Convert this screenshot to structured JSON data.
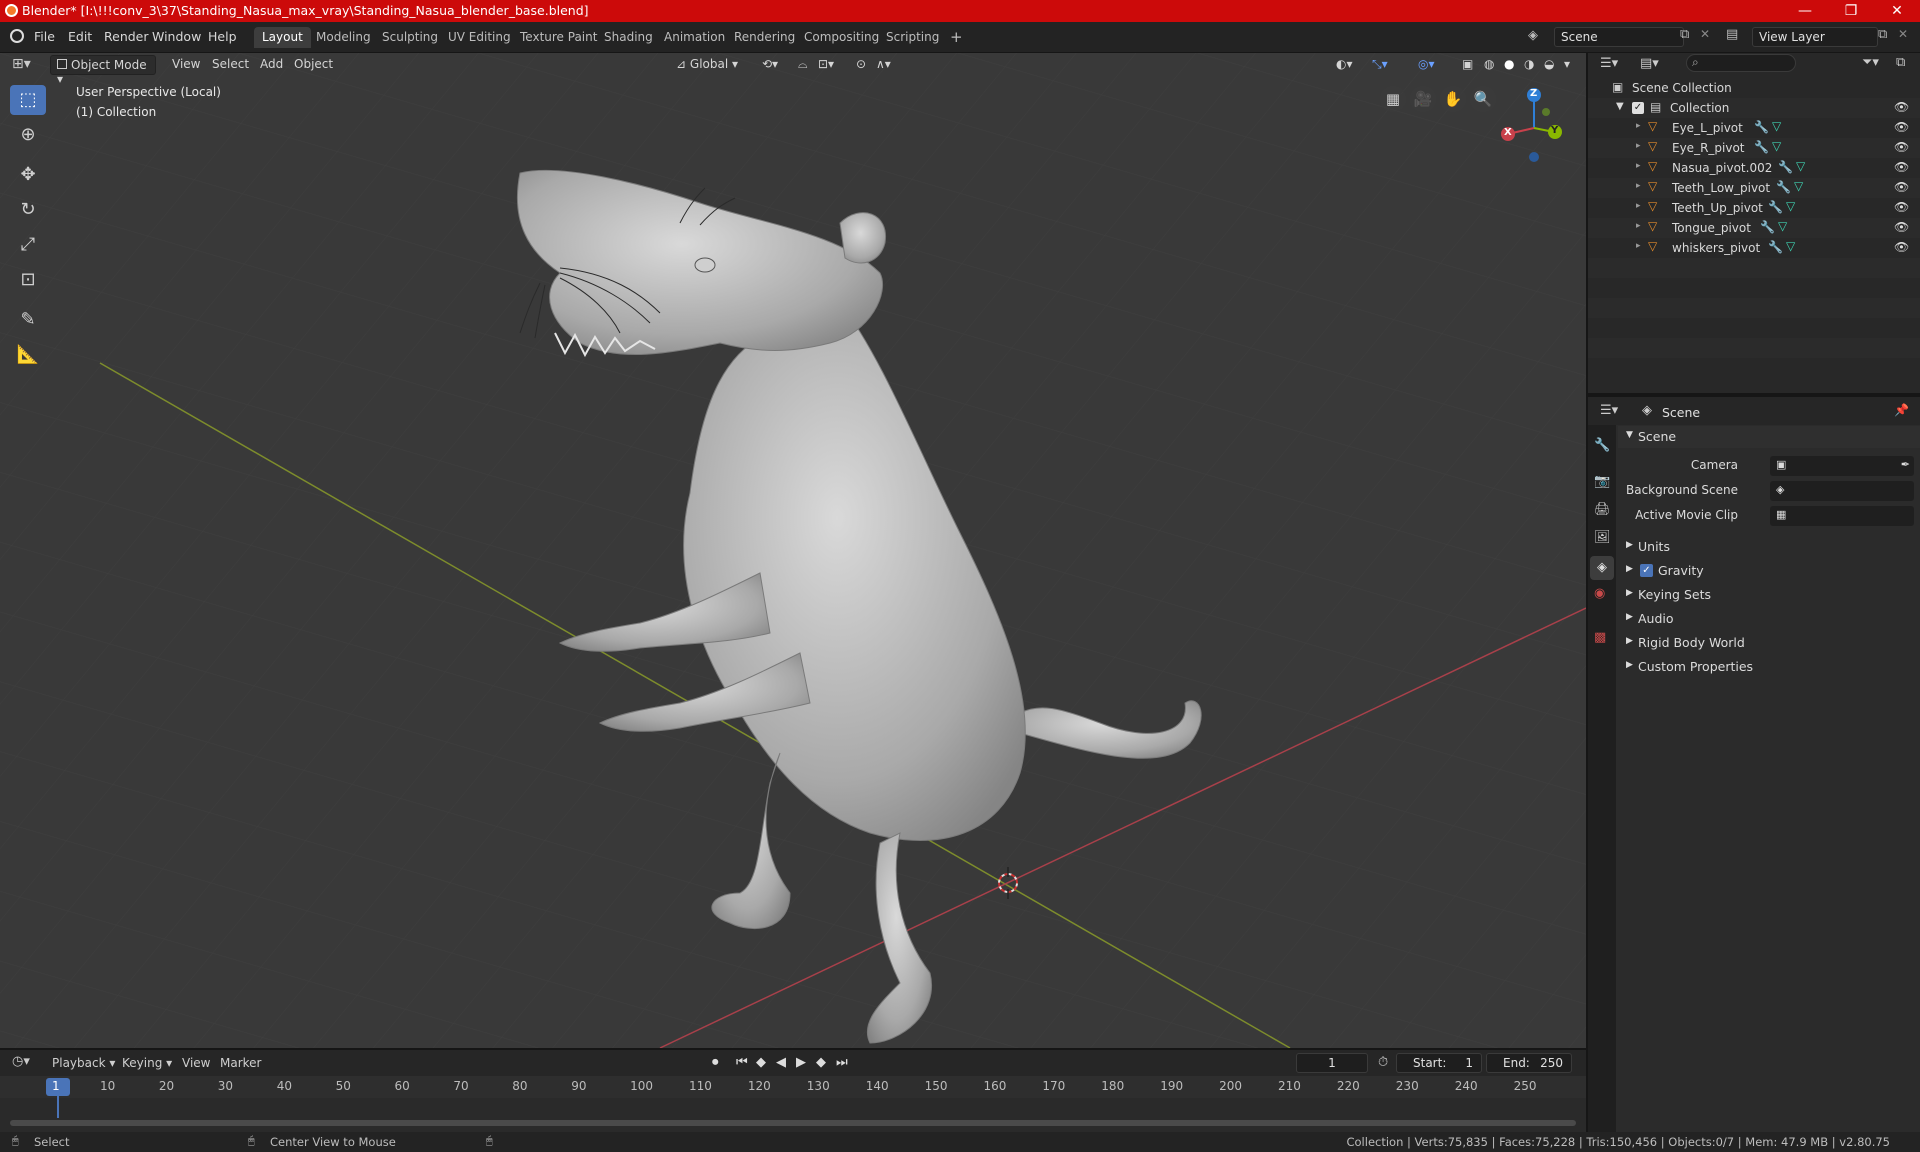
{
  "titlebar": {
    "title": "Blender* [I:\\!!!conv_3\\37\\Standing_Nasua_max_vray\\Standing_Nasua_blender_base.blend]",
    "minimize": "—",
    "maximize": "❐",
    "close": "✕"
  },
  "menu": {
    "items": [
      "File",
      "Edit",
      "Render",
      "Window",
      "Help"
    ]
  },
  "workspaces": {
    "tabs": [
      "Layout",
      "Modeling",
      "Sculpting",
      "UV Editing",
      "Texture Paint",
      "Shading",
      "Animation",
      "Rendering",
      "Compositing",
      "Scripting"
    ],
    "add": "+",
    "active": "Layout"
  },
  "scene_selector": {
    "value": "Scene"
  },
  "view_layer_selector": {
    "value": "View Layer"
  },
  "viewport_header": {
    "mode": "Object Mode",
    "menus": [
      "View",
      "Select",
      "Add",
      "Object"
    ],
    "transform_orientation": "Global"
  },
  "viewport": {
    "perspective_label": "User Perspective (Local)",
    "collection_label": "(1) Collection",
    "gizmo": {
      "x": "X",
      "y": "Y",
      "z": "Z"
    }
  },
  "outliner": {
    "search_placeholder": "",
    "root": "Scene Collection",
    "collection": "Collection",
    "items": [
      {
        "name": "Eye_L_pivot"
      },
      {
        "name": "Eye_R_pivot"
      },
      {
        "name": "Nasua_pivot.002"
      },
      {
        "name": "Teeth_Low_pivot"
      },
      {
        "name": "Teeth_Up_pivot"
      },
      {
        "name": "Tongue_pivot"
      },
      {
        "name": "whiskers_pivot"
      }
    ]
  },
  "properties": {
    "context": "Scene",
    "panel_title": "Scene",
    "fields": [
      {
        "label": "Camera",
        "value": ""
      },
      {
        "label": "Background Scene",
        "value": ""
      },
      {
        "label": "Active Movie Clip",
        "value": ""
      }
    ],
    "subpanels": [
      "Units",
      "Gravity",
      "Keying Sets",
      "Audio",
      "Rigid Body World",
      "Custom Properties"
    ],
    "gravity_checked": true
  },
  "timeline": {
    "menus": [
      "Playback",
      "Keying",
      "View",
      "Marker"
    ],
    "current_frame": "1",
    "start_label": "Start:",
    "start_value": "1",
    "end_label": "End:",
    "end_value": "250",
    "ticks": [
      "1",
      "10",
      "20",
      "30",
      "40",
      "50",
      "60",
      "70",
      "80",
      "90",
      "100",
      "110",
      "120",
      "130",
      "140",
      "150",
      "160",
      "170",
      "180",
      "190",
      "200",
      "210",
      "220",
      "230",
      "240",
      "250"
    ]
  },
  "status": {
    "select": "Select",
    "center_view": "Center View to Mouse",
    "stats": "Collection | Verts:75,835 | Faces:75,228 | Tris:150,456 | Objects:0/7 | Mem: 47.9 MB | v2.80.75"
  },
  "colors": {
    "titlebar": "#cc0a0a",
    "accent": "#4a74b8",
    "axis_x": "#c8414b",
    "axis_y": "#8ab800",
    "axis_z": "#2f7fd6",
    "object_icon": "#e08a2c",
    "mesh_icon": "#3fd0b0"
  }
}
